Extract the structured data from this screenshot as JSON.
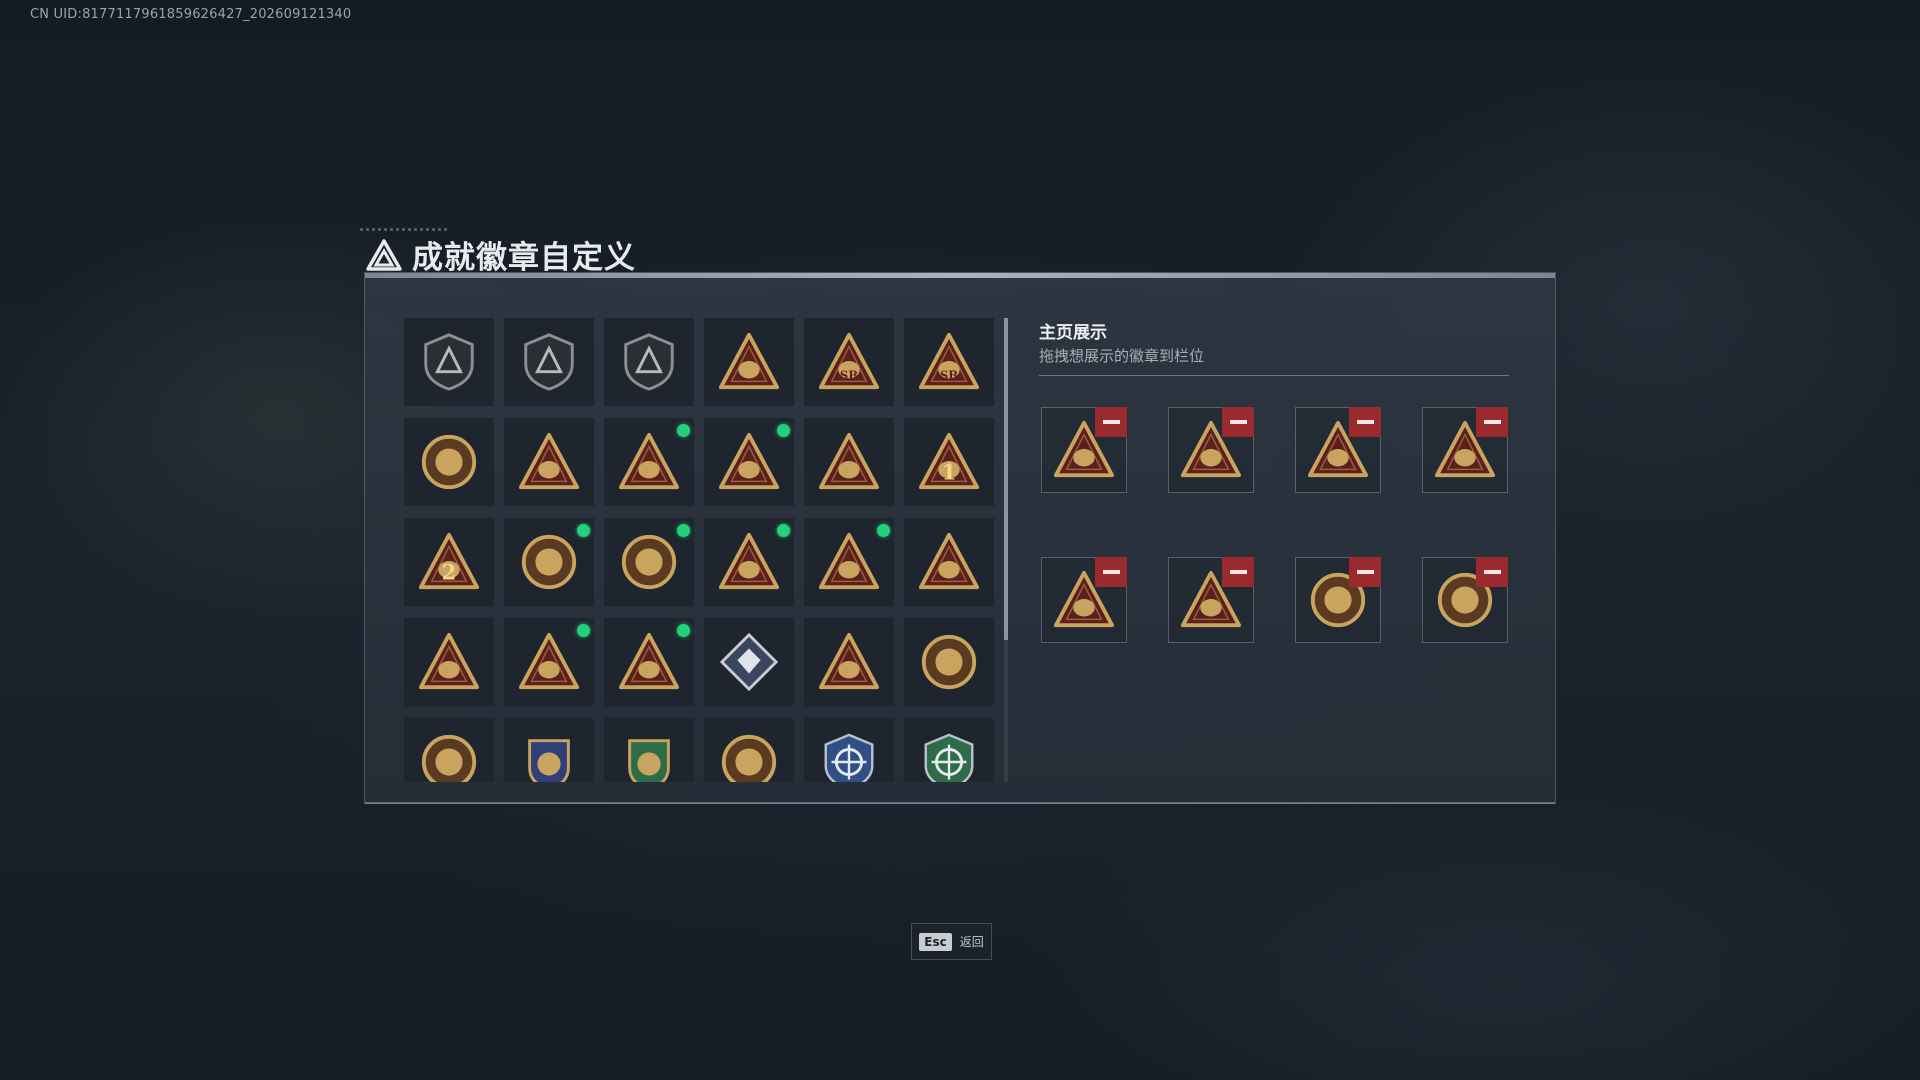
{
  "uid_text": "CN UID:8177117961859626427_202609121340",
  "title": "成就徽章自定义",
  "showcase": {
    "title": "主页展示",
    "subtitle": "拖拽想展示的徽章到栏位"
  },
  "esc": {
    "key_label": "Esc",
    "label": "返回"
  },
  "colors": {
    "new_badge_dot": "#25d07a",
    "remove_button": "#9b2a2f",
    "badge_gold": "#c9a45e",
    "badge_red": "#5c1f1c"
  },
  "badge_grid": [
    {
      "icon": "shield-dark-badge-icon",
      "glyph": "",
      "new": false
    },
    {
      "icon": "helicopter-shield-badge-icon",
      "glyph": "",
      "new": false
    },
    {
      "icon": "wings-shield-badge-icon",
      "glyph": "",
      "new": false
    },
    {
      "icon": "gift-triangle-badge-icon",
      "glyph": "",
      "new": false
    },
    {
      "icon": "sb-triangle-badge-icon",
      "glyph": "SB",
      "new": false
    },
    {
      "icon": "sb-winged-triangle-badge-icon",
      "glyph": "SB",
      "new": false
    },
    {
      "icon": "gear-medal-badge-icon",
      "glyph": "",
      "new": false
    },
    {
      "icon": "hand-sign-triangle-badge-icon",
      "glyph": "",
      "new": false
    },
    {
      "icon": "tank-triangle-badge-icon",
      "glyph": "",
      "new": true
    },
    {
      "icon": "soldier-triangle-badge-icon",
      "glyph": "",
      "new": true
    },
    {
      "icon": "boat-triangle-badge-icon",
      "glyph": "",
      "new": false
    },
    {
      "icon": "number-1-triangle-badge-icon",
      "glyph": "1",
      "new": false
    },
    {
      "icon": "number-2-triangle-badge-icon",
      "glyph": "2",
      "new": false
    },
    {
      "icon": "dragon-emblem-badge-icon",
      "glyph": "",
      "new": true
    },
    {
      "icon": "globe-emblem-badge-icon",
      "glyph": "",
      "new": true
    },
    {
      "icon": "supply-triangle-badge-icon",
      "glyph": "",
      "new": true
    },
    {
      "icon": "runner-triangle-badge-icon",
      "glyph": "",
      "new": true
    },
    {
      "icon": "heart-triangle-badge-icon",
      "glyph": "",
      "new": false
    },
    {
      "icon": "beast-triangle-badge-icon",
      "glyph": "",
      "new": false
    },
    {
      "icon": "winged-beast-triangle-badge-icon",
      "glyph": "",
      "new": true
    },
    {
      "icon": "rocket-triangle-badge-icon",
      "glyph": "",
      "new": true
    },
    {
      "icon": "diamond-crystal-badge-icon",
      "glyph": "",
      "new": false
    },
    {
      "icon": "firefighter-triangle-badge-icon",
      "glyph": "",
      "new": false
    },
    {
      "icon": "star-compass-medal-badge-icon",
      "glyph": "",
      "new": false
    },
    {
      "icon": "small-shield-badge-icon",
      "glyph": "",
      "new": false
    },
    {
      "icon": "blue-crest-badge-icon",
      "glyph": "",
      "new": false
    },
    {
      "icon": "green-crest-badge-icon",
      "glyph": "",
      "new": false
    },
    {
      "icon": "skull-medal-badge-icon",
      "glyph": "",
      "new": false
    },
    {
      "icon": "crosshair-blue-badge-icon",
      "glyph": "",
      "new": false
    },
    {
      "icon": "crosshair-green-badge-icon",
      "glyph": "",
      "new": false
    }
  ],
  "showcase_slots": [
    {
      "icon": "supply-triangle-badge-icon",
      "glyph": ""
    },
    {
      "icon": "rocket-triangle-badge-icon",
      "glyph": ""
    },
    {
      "icon": "runner-triangle-badge-icon",
      "glyph": ""
    },
    {
      "icon": "winged-beast-triangle-badge-icon",
      "glyph": ""
    },
    {
      "icon": "soldier-triangle-badge-icon",
      "glyph": ""
    },
    {
      "icon": "tank-triangle-badge-icon",
      "glyph": ""
    },
    {
      "icon": "dragon-emblem-badge-icon",
      "glyph": ""
    },
    {
      "icon": "globe-emblem-badge-icon",
      "glyph": ""
    }
  ]
}
